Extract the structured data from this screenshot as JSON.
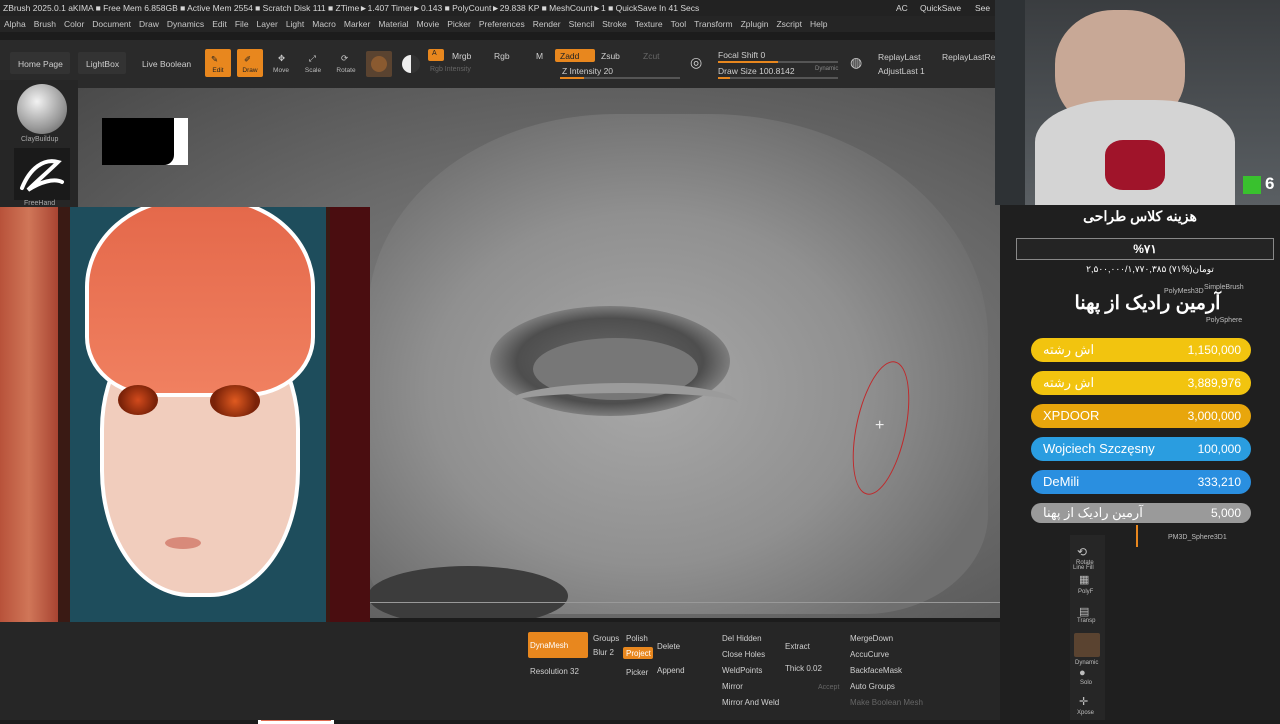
{
  "titlebar": {
    "text": "ZBrush 2025.0.1    aKIMA    ■ Free Mem 6.858GB ■ Active Mem 2554 ■ Scratch Disk 111 ■ ZTime►1.407 Timer►0.143 ■ PolyCount►29.838 KP ■ MeshCount►1 ■ QuickSave In 41 Secs",
    "ac": "AC",
    "quicksave": "QuickSave",
    "see": "See"
  },
  "menu": [
    "Alpha",
    "Brush",
    "Color",
    "Document",
    "Draw",
    "Dynamics",
    "Edit",
    "File",
    "Layer",
    "Light",
    "Macro",
    "Marker",
    "Material",
    "Movie",
    "Picker",
    "Preferences",
    "Render",
    "Stencil",
    "Stroke",
    "Texture",
    "Tool",
    "Transform",
    "Zplugin",
    "Zscript",
    "Help"
  ],
  "toolbar": {
    "home_page": "Home Page",
    "lightbox": "LightBox",
    "live_boolean": "Live Boolean",
    "edit": "Edit",
    "draw": "Draw",
    "move": "Move",
    "scale": "Scale",
    "rotate": "Rotate",
    "a_label": "A",
    "mrgb": "Mrgb",
    "rgb": "Rgb",
    "m": "M",
    "zadd": "Zadd",
    "zsub": "Zsub",
    "zcut": "Zcut",
    "rgb_intensity": "Rgb Intensity",
    "z_intensity": "Z Intensity 20",
    "focal_shift": "Focal Shift 0",
    "draw_size": "Draw Size 100.8142",
    "dynamic": "Dynamic",
    "replay_last": "ReplayLast",
    "replay_last_rel": "ReplayLastRel",
    "adjust_last": "AdjustLast 1",
    "focal_shift_level": 0.5,
    "draw_size_level": 0.1,
    "z_intensity_level": 0.2
  },
  "shelf": {
    "clay_buildup": "ClayBuildup",
    "freehand": "FreeHand"
  },
  "bottom": {
    "dynamesh": "DynaMesh",
    "groups": "Groups",
    "polish": "Polish",
    "blur": "Blur 2",
    "project": "Project",
    "resolution": "Resolution 32",
    "picker": "Picker",
    "delete": "Delete",
    "append": "Append",
    "del_hidden": "Del Hidden",
    "close_holes": "Close Holes",
    "weld_points": "WeldPoints",
    "mirror": "Mirror",
    "mirror_and_weld": "Mirror And Weld",
    "extract": "Extract",
    "thick": "Thick 0.02",
    "accept": "Accept",
    "merge_down": "MergeDown",
    "accu_curve": "AccuCurve",
    "backface_mask": "BackfaceMask",
    "auto_groups": "Auto Groups",
    "make_boolean_mesh": "Make Boolean Mesh"
  },
  "overlay": {
    "badge_number": "6",
    "campaign_title": "هزینه کلاس طراحی",
    "campaign_percent": "%۷۱",
    "campaign_amount": "۲,۵۰۰,۰۰۰/۱,۷۷۰,۳۸۵ تومان(%۷۱)",
    "top_donor": "آرمین رادیک از پهنا",
    "donors": [
      {
        "name": "اش رشته",
        "amount": "1,150,000",
        "color": "#f2c40f"
      },
      {
        "name": "اش رشته",
        "amount": "3,889,976",
        "color": "#f2c40f"
      },
      {
        "name": "XPDOOR",
        "amount": "3,000,000",
        "color": "#e8a60c"
      },
      {
        "name": "Wojciech Szczęsny",
        "amount": "100,000",
        "color": "#2a9de0"
      },
      {
        "name": "DeMili",
        "amount": "333,210",
        "color": "#2a8fe0"
      },
      {
        "name": "آرمین رادیک از پهنا",
        "amount": "5,000",
        "color": "#9a9a9a"
      }
    ]
  },
  "rightpanel": {
    "polymesh3d": "PolyMesh3D",
    "simplebrush": "SimpleBrush",
    "polysphere": "PolySphere",
    "pm3d_sphere": "PM3D_Sphere3D1",
    "rotate": "Rotate",
    "line_fill": "Line Fill",
    "polyf": "PolyF",
    "transp": "Transp",
    "dynamic": "Dynamic",
    "solo": "Solo",
    "xpose": "Xpose"
  }
}
